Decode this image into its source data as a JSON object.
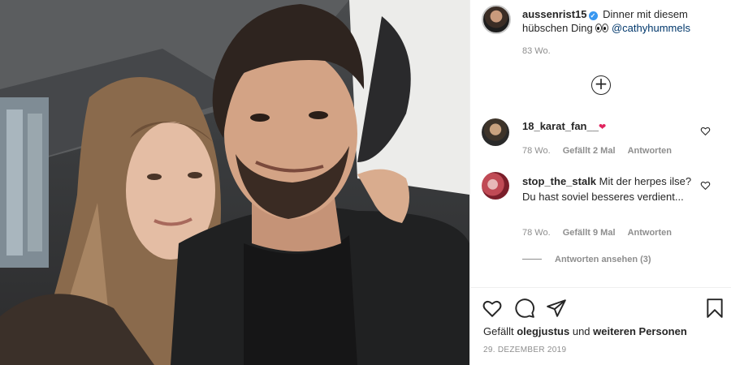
{
  "post": {
    "author": "aussenrist15",
    "verified": true,
    "caption_text": "Dinner mit diesem hübschen Ding",
    "caption_mention": "@cathyhummels",
    "caption_time": "83 Wo.",
    "likes_prefix": "Gefällt",
    "likes_user": "olegjustus",
    "likes_connector": "und",
    "likes_suffix": "weiteren Personen",
    "date": "29. DEZEMBER 2019"
  },
  "comments": [
    {
      "username": "18_karat_fan__",
      "text": "",
      "time": "78 Wo.",
      "likes": "Gefällt 2 Mal",
      "reply": "Antworten"
    },
    {
      "username": "stop_the_stalk",
      "text": "Mit der herpes ilse? Du hast soviel besseres verdient...",
      "time": "78 Wo.",
      "likes": "Gefällt 9 Mal",
      "reply": "Antworten"
    }
  ],
  "view_replies": "Antworten ansehen (3)",
  "icons": {
    "load_more": "plus-circle-icon",
    "like": "heart-outline-icon",
    "comment": "speech-bubble-icon",
    "share": "paper-plane-icon",
    "save": "bookmark-icon",
    "verified": "verified-badge-icon"
  },
  "colors": {
    "text": "#262626",
    "muted": "#8e8e8e",
    "mention": "#00376b",
    "verified": "#3897f0",
    "border": "#efefef"
  }
}
